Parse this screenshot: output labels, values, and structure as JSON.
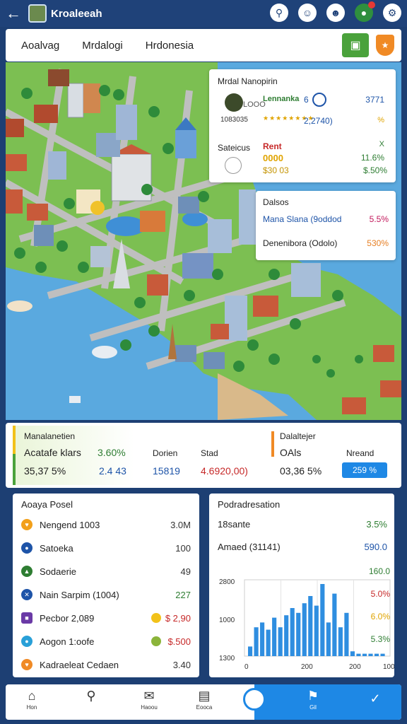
{
  "header": {
    "title": "Kroaleeah",
    "icons": [
      "back-arrow-icon",
      "pin-icon",
      "face-icon",
      "smiley-icon",
      "notification-icon",
      "settings-icon"
    ]
  },
  "tabs": [
    {
      "label": "Aoalvag"
    },
    {
      "label": "Mrdalogi"
    },
    {
      "label": "Hrdonesia"
    }
  ],
  "overlay_main": {
    "title": "Mrdal Nanopirin",
    "badge": "LOOO",
    "sub": "1083035",
    "name1": "Lennanka",
    "mid1": "6",
    "right1": "3771",
    "stars": "★★★★★★★★",
    "mid2": "2,2740)",
    "right2": "%",
    "section2": "Sateicus",
    "rent": "Rent",
    "right3": "X",
    "gold1": "0000",
    "gold2": "$30 03",
    "right4": "11.6%",
    "right5": "$.50%"
  },
  "overlay_small": {
    "title": "Dalsos",
    "row1_label": "Mana Slana (9oddod",
    "row1_value": "5.5%",
    "row2_label": "Denenibora (Odolo)",
    "row2_value": "530%"
  },
  "stats": {
    "title1": "Manalanetien",
    "label_a": "Acatafe klars",
    "val_a": "3.60%",
    "sub_a": "35,37 5%",
    "sub_b": "2.4 43",
    "col2_head": "Dorien",
    "col2_val": "15819",
    "col3_head": "Stad",
    "col3_val": "4.6920,00)",
    "title2": "Dalaltejer",
    "col4_head": "OAls",
    "col4_val": "03,36 5%",
    "col5_head": "Nreand",
    "col5_val": "259 %"
  },
  "left_card": {
    "title": "Aoaya Posel",
    "rows": [
      {
        "label": "Nengend 1003",
        "value": "3.0M"
      },
      {
        "label": "Satoeka",
        "value": "100"
      },
      {
        "label": "Sodaerie",
        "value": "49"
      },
      {
        "label": "Nain Sarpim (1004)",
        "value": "227"
      },
      {
        "label": "Pecbor 2,089",
        "value": "$ 2,90"
      },
      {
        "label": "Aogon 1:oofe",
        "value": "$.500"
      },
      {
        "label": "Kadraeleat Cedaen",
        "value": "3.40"
      }
    ]
  },
  "right_card": {
    "title": "Podradresation",
    "row1_label": "18sante",
    "row1_value": "3.5%",
    "row2_label": "Amaed (31141)",
    "row2_value": "590.0",
    "right_vals": [
      "160.0",
      "5.0%",
      "6.0%",
      "5.3%"
    ]
  },
  "chart_data": {
    "type": "bar",
    "y_tick_labels": [
      "2800",
      "1000",
      "1300"
    ],
    "x_tick_labels": [
      "0",
      "200",
      "200",
      "100"
    ],
    "values": [
      4,
      12,
      14,
      11,
      16,
      12,
      17,
      20,
      18,
      22,
      25,
      21,
      30,
      14,
      26,
      12,
      18,
      2,
      1,
      1,
      1,
      1,
      1
    ],
    "color": "#2f8ee0",
    "grid": true
  },
  "nav": {
    "items": [
      {
        "label": "Hon"
      },
      {
        "label": ""
      },
      {
        "label": "Haoou"
      },
      {
        "label": "Eooca"
      },
      {
        "label": "Gil"
      },
      {
        "label": ""
      }
    ]
  },
  "colors": {
    "header_bg": "#1f4279",
    "accent_blue": "#1e88e5",
    "accent_green": "#4aa23b",
    "water": "#5aa9df"
  }
}
